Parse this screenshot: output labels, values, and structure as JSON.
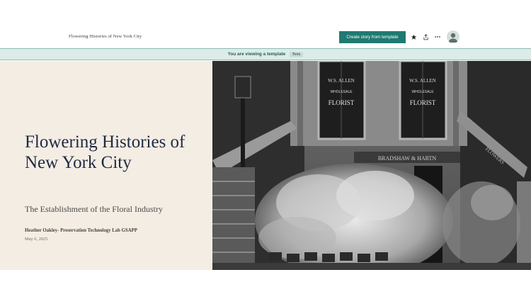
{
  "header": {
    "site_title": "Flowering Histories of New York City",
    "create_button_label": "Create story from template",
    "favorite_icon": "star-icon",
    "share_icon": "share-icon",
    "more_icon": "more-dots-icon",
    "avatar_icon": "user-avatar-icon"
  },
  "banner": {
    "text": "You are viewing a template",
    "badge": "Beta"
  },
  "hero": {
    "title": "Flowering Histories of New York City",
    "subtitle": "The Establishment of the Floral Industry",
    "author": "Heather Oakley- Preservation Technology Lab GSAPP",
    "date": "May 6, 2025",
    "photo": {
      "sign_left": "W.S. ALLEN",
      "sign_left_sub": "WHOLESALE",
      "sign_left_main": "FLORIST",
      "sign_right": "W.S. ALLEN",
      "sign_right_sub": "WHOLESALE",
      "sign_right_main": "FLORIST",
      "awning_text": "BRADSHAW & HARTN",
      "rail_text": "FLOWERS"
    }
  },
  "colors": {
    "accent": "#1f7a72",
    "banner_bg": "#dcece8",
    "hero_bg": "#f4ede3",
    "title_color": "#1f2a44"
  }
}
